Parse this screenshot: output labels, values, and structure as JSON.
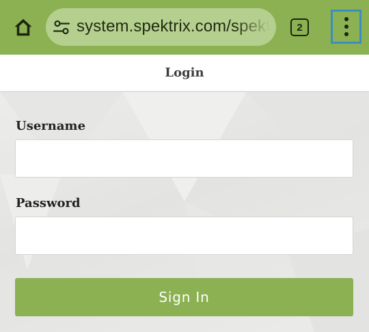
{
  "browser": {
    "url": "system.spektrix.com/spektr",
    "tab_count": "2",
    "toolbar_color": "#8bb153",
    "icons": [
      "home-icon",
      "site-settings-icon",
      "tab-switcher-icon",
      "more-vert-icon"
    ]
  },
  "page": {
    "title": "Login"
  },
  "form": {
    "username_label": "Username",
    "username_value": "",
    "password_label": "Password",
    "password_value": "",
    "signin_label": "Sign In",
    "button_color": "#8bb153"
  }
}
